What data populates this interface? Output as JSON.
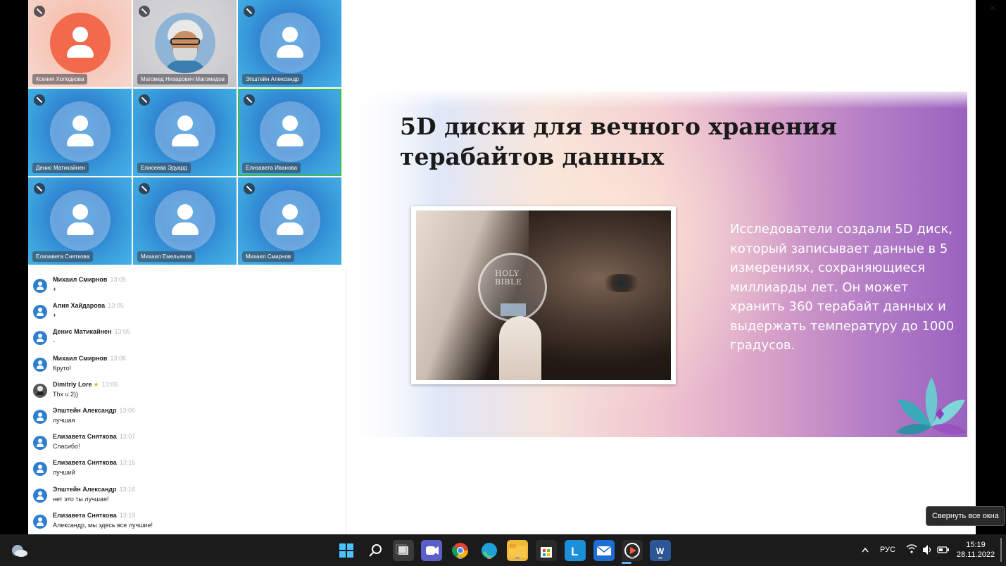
{
  "window": {
    "close_label": "×"
  },
  "participants": [
    {
      "name": "Ксения Холодкова",
      "style": "orange",
      "icon": "person-icon"
    },
    {
      "name": "Магомед Низарович Магомедов",
      "style": "grey",
      "icon": "avatar-photo"
    },
    {
      "name": "Эпштейн Александр",
      "style": "blue",
      "icon": "person-icon"
    },
    {
      "name": "Денис Матикайнен",
      "style": "blue",
      "icon": "person-icon"
    },
    {
      "name": "Елисеева Эдуард",
      "style": "blue",
      "icon": "person-icon"
    },
    {
      "name": "Елизавета Иванова",
      "style": "blue-active",
      "icon": "person-icon"
    },
    {
      "name": "Елизавета Сняткова",
      "style": "blue",
      "icon": "person-icon"
    },
    {
      "name": "Михаил Емельянов",
      "style": "blue",
      "icon": "person-icon"
    },
    {
      "name": "Михаил Смирнов",
      "style": "blue",
      "icon": "person-icon"
    }
  ],
  "chat": {
    "messages": [
      {
        "author": "Михаил Смирнов",
        "time": "13:05",
        "text": "+"
      },
      {
        "author": "Алия Хайдарова",
        "time": "13:05",
        "text": "+"
      },
      {
        "author": "Денис Матикайнен",
        "time": "13:05",
        "text": "-"
      },
      {
        "author": "Михаил Смирнов",
        "time": "13:06",
        "text": "Круто!"
      },
      {
        "author": "Dimitriy Lore",
        "star": "★",
        "time": "13:06",
        "text": "Thx u 2))"
      },
      {
        "author": "Эпштейн Александр",
        "time": "13:06",
        "text": "лучшая"
      },
      {
        "author": "Елизавета Сняткова",
        "time": "13:07",
        "text": "Спасибо!"
      },
      {
        "author": "Елизавета Сняткова",
        "time": "13:16",
        "text": "лучший"
      },
      {
        "author": "Эпштейн Александр",
        "time": "13:16",
        "text": "нет это ты лучшая!"
      },
      {
        "author": "Елизавета Сняткова",
        "time": "13:19",
        "text": "Александр, мы здесь все лучшие!"
      }
    ]
  },
  "slide": {
    "title_line1": "5D диски для вечного хранения",
    "title_line2": "терабайтов данных",
    "body": "Исследователи создали 5D диск, который записывает данные в 5 измерениях, сохраняющиеся миллиарды лет. Он может хранить 360 терабайт данных и выдержать температуру до 1000 градусов.",
    "photo_disc_text_1": "HOLY",
    "photo_disc_text_2": "BIBLE"
  },
  "taskbar": {
    "apps": [
      "windows-start-icon",
      "search-icon",
      "task-view-icon",
      "teams-chat-icon",
      "chrome-icon",
      "edge-icon",
      "file-explorer-icon",
      "store-icon",
      "lcloud-app-icon",
      "mail-icon",
      "media-player-icon",
      "word-icon"
    ],
    "language": "РУС",
    "time": "15:19",
    "date": "28.11.2022",
    "tooltip": "Свернуть все окна"
  }
}
